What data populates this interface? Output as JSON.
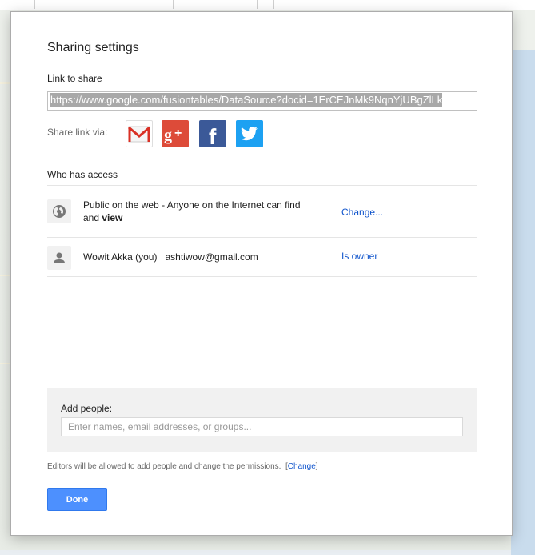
{
  "dialog": {
    "title": "Sharing settings",
    "link_label": "Link to share",
    "link_value": "https://www.google.com/fusiontables/DataSource?docid=1ErCEJnMk9NqnYjUBgZlLk",
    "share_via_label": "Share link via:",
    "share_icons": [
      "gmail-icon",
      "google-plus-icon",
      "facebook-icon",
      "twitter-icon"
    ],
    "access_label": "Who has access",
    "access": [
      {
        "icon": "globe-icon",
        "text_prefix": "Public on the web - Anyone on the Internet can find and ",
        "text_bold": "view",
        "action": "Change..."
      },
      {
        "icon": "person-icon",
        "name": "Wowit Akka (you)",
        "email": "ashtiwow@gmail.com",
        "action": "Is owner"
      }
    ],
    "add_people_label": "Add people:",
    "add_people_placeholder": "Enter names, email addresses, or groups...",
    "editors_note": "Editors will be allowed to add people and change the permissions.",
    "editors_link": "Change",
    "done_label": "Done"
  },
  "colors": {
    "primary_button": "#4d90fe",
    "link": "#1155cc",
    "gplus": "#dd4b39",
    "facebook": "#3b5998",
    "twitter": "#1da1f2"
  }
}
